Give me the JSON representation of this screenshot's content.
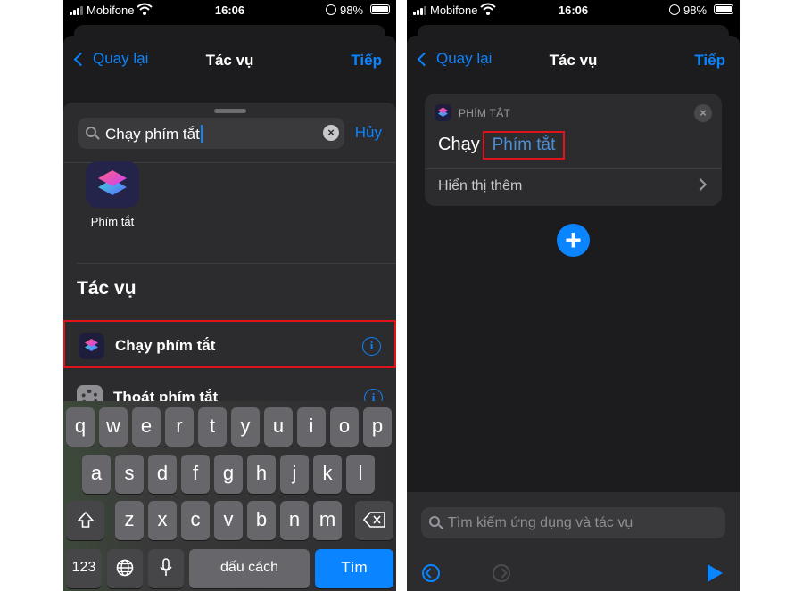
{
  "status_bar": {
    "carrier": "Mobifone",
    "time": "16:06",
    "battery": "98%"
  },
  "nav": {
    "back_label": "Quay lại",
    "title": "Tác vụ",
    "next_label": "Tiếp"
  },
  "left_screen": {
    "search": {
      "value": "Chạy phím tắt",
      "cancel_label": "Hủy"
    },
    "app_result": {
      "label": "Phím tắt",
      "icon": "shortcuts-app-icon"
    },
    "section_title": "Tác vụ",
    "actions": [
      {
        "label": "Chạy phím tắt",
        "icon": "shortcuts-icon",
        "highlighted": true
      },
      {
        "label": "Thoát phím tắt",
        "icon": "settings-gear-icon",
        "highlighted": false
      }
    ],
    "keyboard": {
      "row1": [
        "q",
        "w",
        "e",
        "r",
        "t",
        "y",
        "u",
        "i",
        "o",
        "p"
      ],
      "row2": [
        "a",
        "s",
        "d",
        "f",
        "g",
        "h",
        "j",
        "k",
        "l"
      ],
      "row3": [
        "z",
        "x",
        "c",
        "v",
        "b",
        "n",
        "m"
      ],
      "numbers_label": "123",
      "space_label": "dấu cách",
      "go_label": "Tìm"
    }
  },
  "right_screen": {
    "action_card": {
      "app_name": "PHÍM TẮT",
      "verb": "Chạy",
      "parameter": "Phím tắt",
      "show_more": "Hiển thị thêm"
    },
    "bottom_search_placeholder": "Tìm kiếm ứng dụng và tác vụ"
  },
  "colors": {
    "accent": "#0a84ff",
    "highlight": "#e0151c",
    "background": "#1c1c1e"
  }
}
